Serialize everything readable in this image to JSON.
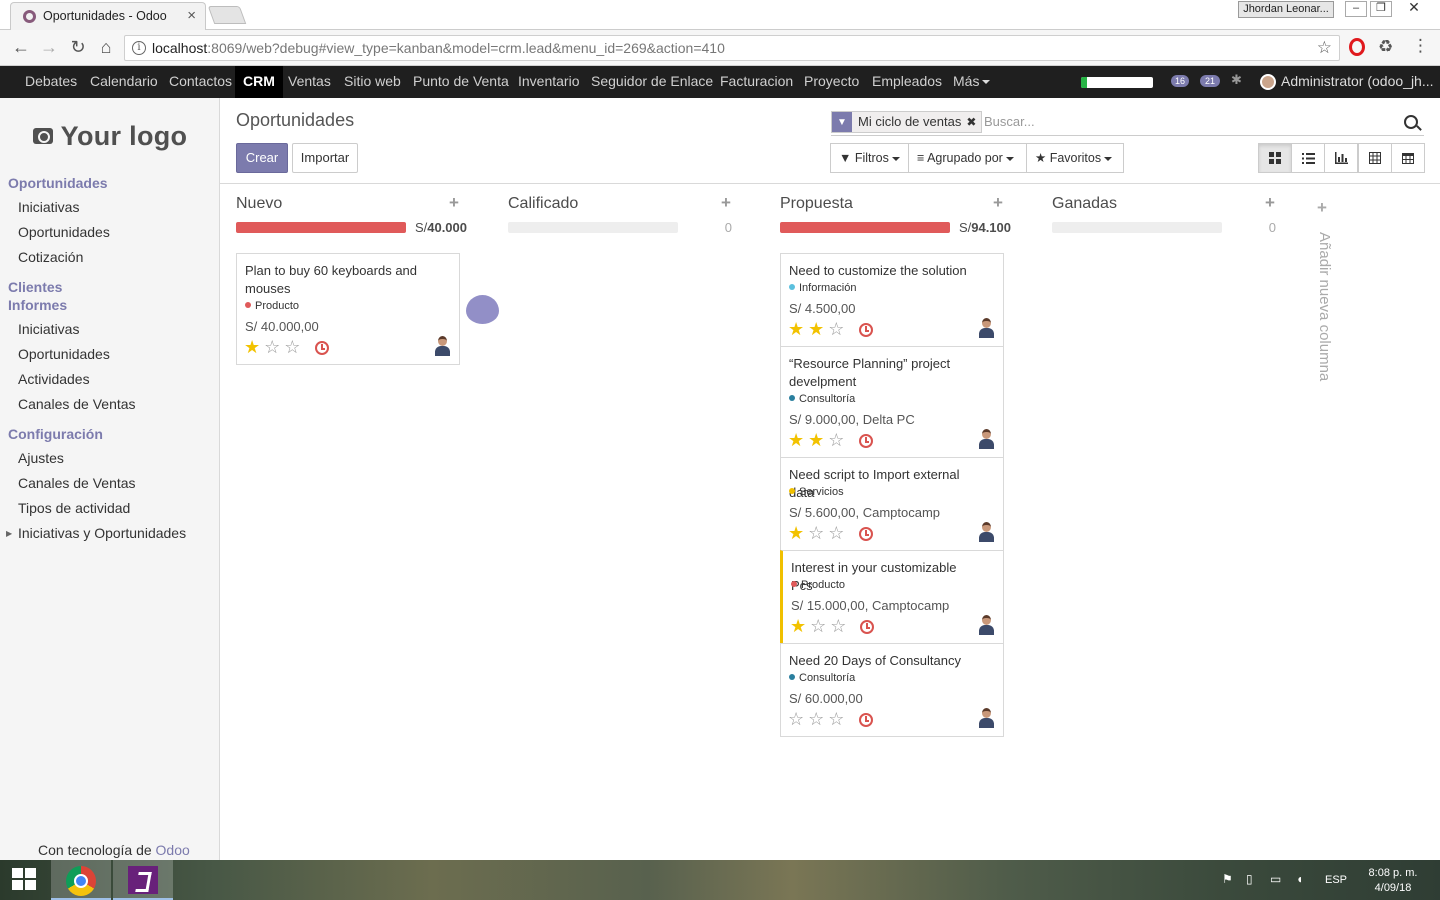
{
  "browser": {
    "tab_title": "Oportunidades - Odoo",
    "user_badge": "Jhordan Leonar...",
    "url_host": "localhost",
    "url_rest": ":8069/web?debug#view_type=kanban&model=crm.lead&menu_id=269&action=410"
  },
  "topmenu": {
    "items": [
      "Debates",
      "Calendario",
      "Contactos",
      "CRM",
      "Ventas",
      "Sitio web",
      "Punto de Venta",
      "Inventario",
      "Seguidor de Enlace",
      "Facturacion",
      "Proyecto",
      "Empleados",
      "Más"
    ],
    "active": "CRM",
    "badge_activities": "16",
    "badge_messages": "21",
    "progress_fraction": 0.08,
    "user": "Administrator (odoo_jh..."
  },
  "sidebar": {
    "logo_text": "Your logo",
    "sections": [
      {
        "title": "Oportunidades",
        "items": [
          "Iniciativas",
          "Oportunidades",
          "Cotización"
        ]
      },
      {
        "title": "Clientes",
        "items": []
      },
      {
        "title": "Informes",
        "items": [
          "Iniciativas",
          "Oportunidades",
          "Actividades",
          "Canales de Ventas"
        ]
      },
      {
        "title": "Configuración",
        "items": [
          "Ajustes",
          "Canales de Ventas",
          "Tipos de actividad",
          "Iniciativas y Oportunidades"
        ]
      }
    ],
    "powered_prefix": "Con tecnología de",
    "powered_brand": "Odoo"
  },
  "control": {
    "breadcrumb": "Oportunidades",
    "create": "Crear",
    "import": "Importar",
    "facet": "Mi ciclo de ventas",
    "search_placeholder": "Buscar...",
    "filters": "Filtros",
    "groupby": "Agrupado por",
    "favorites": "Favoritos"
  },
  "kanban": {
    "columns": [
      {
        "title": "Nuevo",
        "sum": "40.000",
        "sum_prefix": "S/",
        "progress": 1.0
      },
      {
        "title": "Calificado",
        "sum": "0",
        "progress": 0
      },
      {
        "title": "Propuesta",
        "sum": "94.100",
        "sum_prefix": "S/",
        "progress": 1.0
      },
      {
        "title": "Ganadas",
        "sum": "0",
        "progress": 0
      }
    ],
    "cards_nuevo": [
      {
        "title": "Plan to buy 60 keyboards and mouses",
        "tag": "Producto",
        "tag_color": "#e05a5a",
        "amount": "S/ 40.000,00",
        "stars": 1
      }
    ],
    "cards_propuesta": [
      {
        "title": "Need to customize the solution",
        "tag": "Información",
        "tag_color": "#5bc0de",
        "amount": "S/ 4.500,00",
        "stars": 2
      },
      {
        "title": "“Resource Planning” project develpment",
        "tag": "Consultoría",
        "tag_color": "#2a7f9e",
        "amount": "S/ 9.000,00, Delta PC",
        "stars": 2
      },
      {
        "title": "Need script to Import external data",
        "tag": "Servicios",
        "tag_color": "#f0c000",
        "amount": "S/ 5.600,00, Camptocamp",
        "stars": 1
      },
      {
        "title": "Interest in your customizable Pcs",
        "tag": "Producto",
        "tag_color": "#e05a5a",
        "amount": "S/ 15.000,00, Camptocamp",
        "stars": 1
      },
      {
        "title": "Need 20 Days of Consultancy",
        "tag": "Consultoría",
        "tag_color": "#2a7f9e",
        "amount": "S/ 60.000,00",
        "stars": 0
      }
    ],
    "add_column": "Añadir nueva columna"
  },
  "taskbar": {
    "lang": "ESP",
    "time": "8:08 p. m.",
    "date": "4/09/18"
  }
}
